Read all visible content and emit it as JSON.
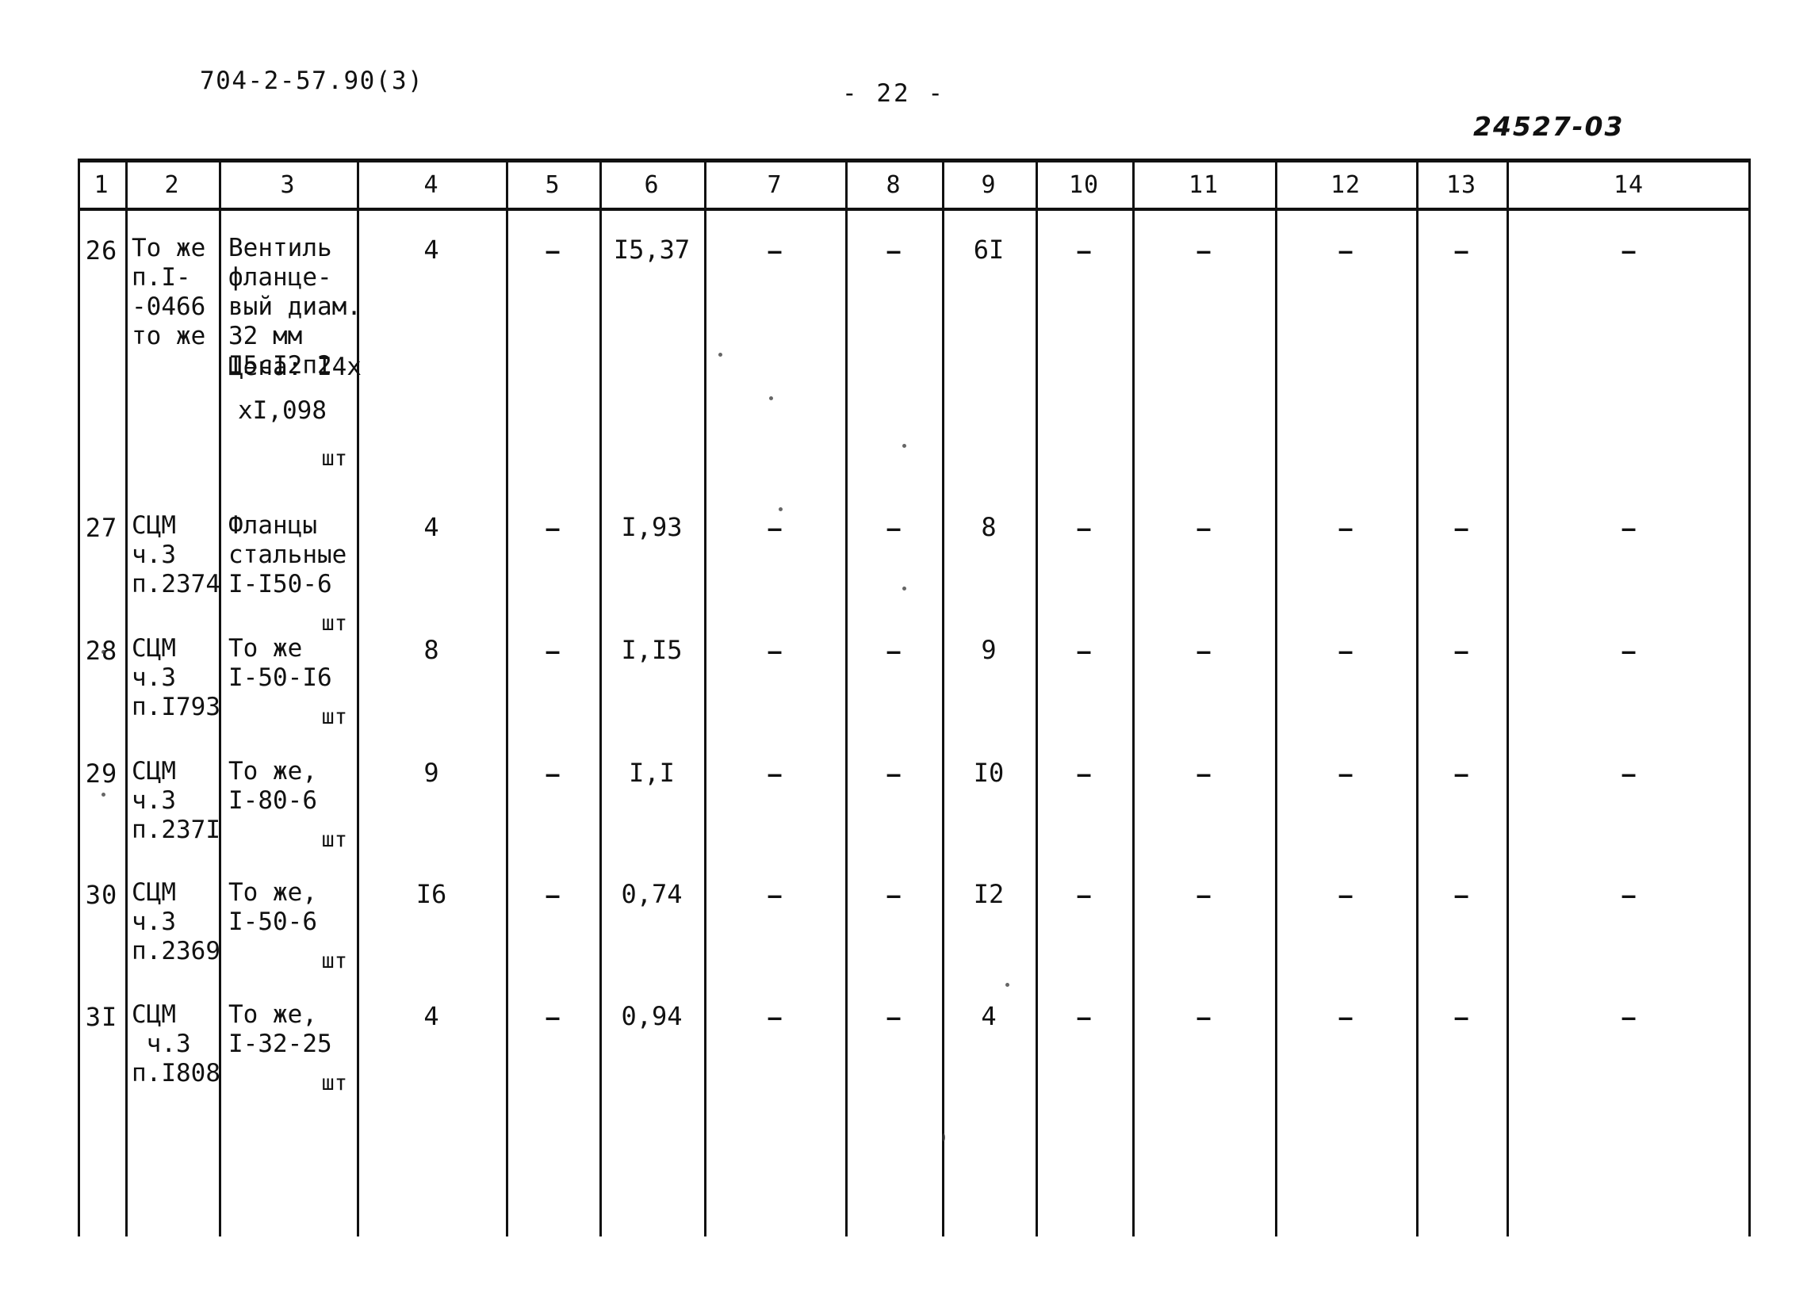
{
  "header": {
    "doc_code": "704-2-57.90(3)",
    "page_number": "- 22 -",
    "archive_code": "24527-03"
  },
  "table": {
    "column_headers": [
      "1",
      "2",
      "3",
      "4",
      "5",
      "6",
      "7",
      "8",
      "9",
      "10",
      "11",
      "12",
      "13",
      "14"
    ],
    "dash_glyph": "—",
    "rows": [
      {
        "num": "26",
        "col2": "То же\nп.I-\n-0466\nто же",
        "col3_main": "Вентиль\nфланце-\nвый диам.\n32 мм\nI5сI2п2",
        "col3_price": "Цена: I4х",
        "col3_price2": "хI,098",
        "col3_unit": "шт",
        "col4": "4",
        "col5": "—",
        "col6": "I5,37",
        "col7": "—",
        "col8": "—",
        "col9": "6I",
        "col10": "—",
        "col11": "—",
        "col12": "—",
        "col13": "—",
        "col14": "—"
      },
      {
        "num": "27",
        "col2": "СЦМ\nч.3\nп.2374",
        "col3_main": "Фланцы\nстальные\nI-I50-6",
        "col3_unit": "шт",
        "col4": "4",
        "col5": "—",
        "col6": "I,93",
        "col7": "—",
        "col8": "—",
        "col9": "8",
        "col10": "—",
        "col11": "—",
        "col12": "—",
        "col13": "—",
        "col14": "—"
      },
      {
        "num": "28",
        "col2": "СЦМ\nч.3\nп.I793",
        "col3_main": "То же\nI-50-I6",
        "col3_unit": "шт",
        "col4": "8",
        "col5": "—",
        "col6": "I,I5",
        "col7": "—",
        "col8": "—",
        "col9": "9",
        "col10": "—",
        "col11": "—",
        "col12": "—",
        "col13": "—",
        "col14": "—"
      },
      {
        "num": "29",
        "col2": "СЦМ\nч.3\nп.237I",
        "col3_main": "То же,\nI-80-6",
        "col3_unit": "шт",
        "col4": "9",
        "col5": "—",
        "col6": "I,I",
        "col7": "—",
        "col8": "—",
        "col9": "I0",
        "col10": "—",
        "col11": "—",
        "col12": "—",
        "col13": "—",
        "col14": "—"
      },
      {
        "num": "30",
        "col2": "СЦМ\nч.3\nп.2369",
        "col3_main": "То же,\nI-50-6",
        "col3_unit": "шт",
        "col4": "I6",
        "col5": "—",
        "col6": "0,74",
        "col7": "—",
        "col8": "—",
        "col9": "I2",
        "col10": "—",
        "col11": "—",
        "col12": "—",
        "col13": "—",
        "col14": "—"
      },
      {
        "num": "3I",
        "col2": "СЦМ\n ч.3\nп.I808",
        "col3_main": "То же,\nI-32-25",
        "col3_unit": "шт",
        "col4": "4",
        "col5": "—",
        "col6": "0,94",
        "col7": "—",
        "col8": "—",
        "col9": "4",
        "col10": "—",
        "col11": "—",
        "col12": "—",
        "col13": "—",
        "col14": "—"
      }
    ]
  }
}
